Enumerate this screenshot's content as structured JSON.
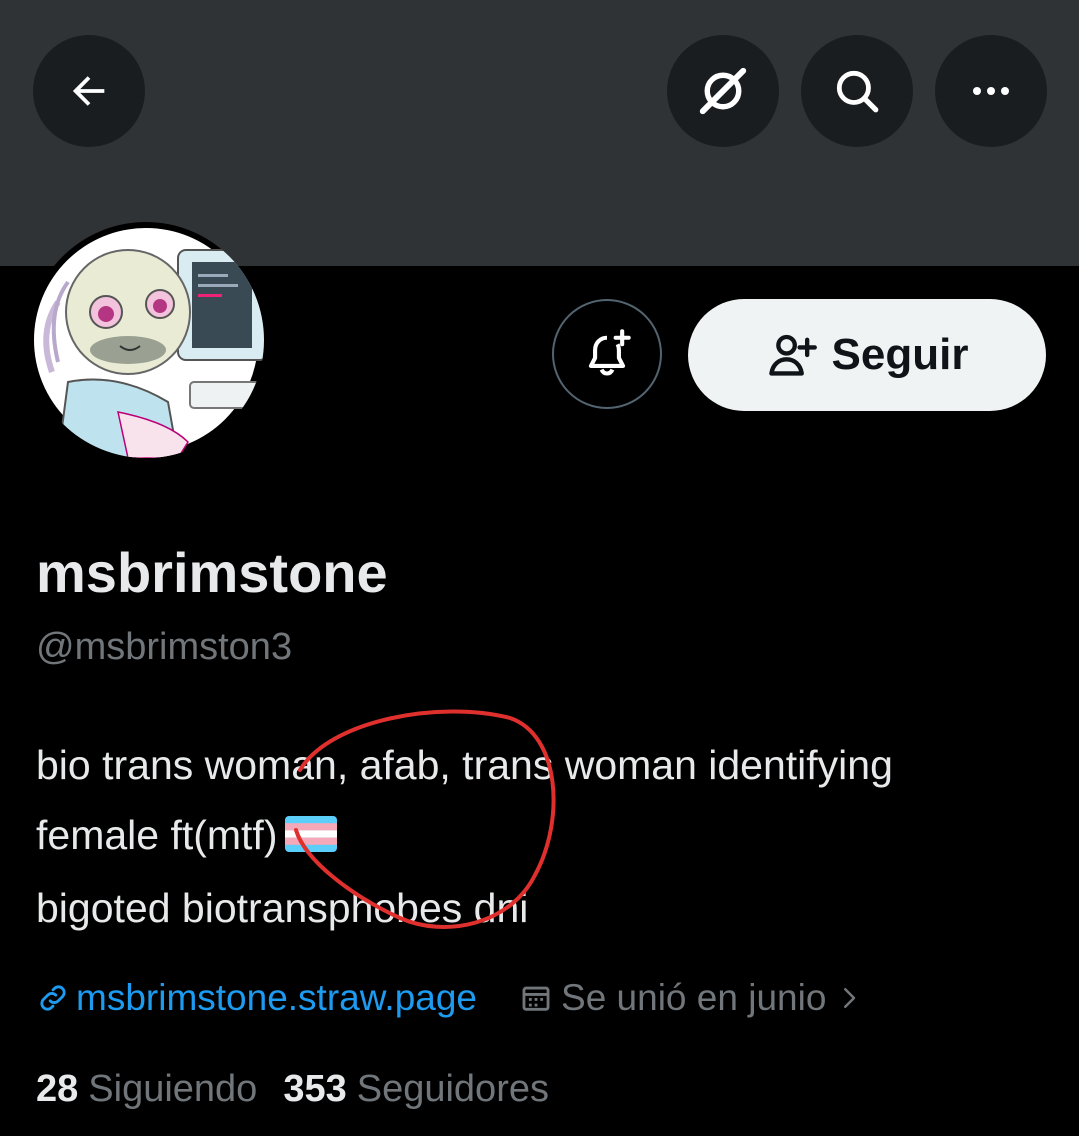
{
  "header": {
    "back_icon": "arrow-left-icon",
    "grok_icon": "grok-slash-icon",
    "search_icon": "search-icon",
    "more_icon": "more-horizontal-icon"
  },
  "profile": {
    "display_name": "msbrimstone",
    "handle": "@msbrimston3",
    "bio_lines": [
      "bio trans woman, afab, trans woman identifying",
      "female ft(mtf)",
      "bigoted biotransphobes dni"
    ],
    "website": "msbrimstone.straw.page",
    "joined": "Se unió en junio",
    "following_count": "28",
    "following_label": "Siguiendo",
    "followers_count": "353",
    "followers_label": "Seguidores"
  },
  "actions": {
    "notify_icon": "bell-plus-icon",
    "follow_label": "Seguir"
  },
  "colors": {
    "banner": "#2f3336",
    "accent_link": "#1d9bf0",
    "muted_text": "#71767b",
    "annotation_circle": "#e0302e",
    "flag_blue": "#5bcefa",
    "flag_pink": "#f5a9b8"
  }
}
